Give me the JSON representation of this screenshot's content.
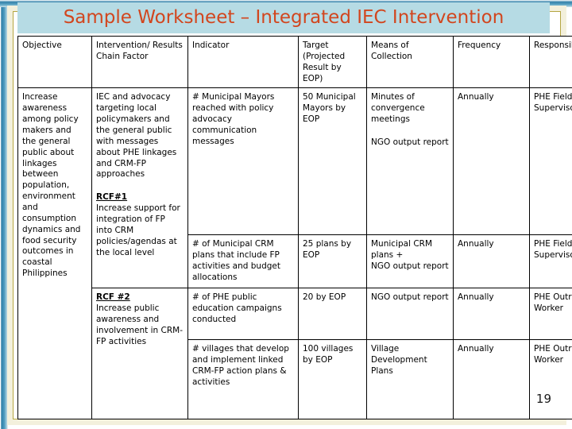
{
  "slide": {
    "title": "Sample Worksheet – Integrated IEC Intervention",
    "page_number": "19",
    "accent_title_color": "#d2461e",
    "title_band_color": "#b6dbe4",
    "frame_color": "#2f7fa8"
  },
  "table": {
    "headers": [
      "Objective",
      "Intervention/ Results Chain Factor",
      "Indicator",
      "Target (Projected Result  by EOP)",
      "Means of Collection",
      "Frequency",
      "Responsible Party"
    ],
    "objective": "Increase awareness among policy makers and the general public about linkages between population, environment and consumption dynamics and food security outcomes in coastal Philippines",
    "intervention_main": "IEC and advocacy targeting local policymakers and the general public with messages about PHE linkages and CRM-FP approaches",
    "rcf1_label": "RCF#1",
    "rcf1_text": "Increase support for integration of FP into CRM policies/agendas at the local level",
    "rcf2_label": "RCF #2",
    "rcf2_text": "Increase public awareness and involvement in CRM-FP activities",
    "rows": [
      {
        "indicator": "# Municipal Mayors reached with policy advocacy communication messages",
        "target": "50 Municipal Mayors by EOP",
        "means_line1": "Minutes of convergence meetings",
        "means_line2": "NGO output report",
        "frequency": "Annually",
        "responsible": "PHE Field Supervisor"
      },
      {
        "indicator": "# of Municipal CRM plans that include FP activities and budget allocations",
        "target": "25 plans by EOP",
        "means_line1": "Municipal CRM plans +",
        "means_line2": "NGO output report",
        "frequency": "Annually",
        "responsible": "PHE Field Supervisor"
      },
      {
        "indicator": "# of PHE public education campaigns conducted",
        "target": "20 by EOP",
        "means_line1": "NGO output report",
        "means_line2": "",
        "frequency": "Annually",
        "responsible": "PHE Outreach Worker"
      },
      {
        "indicator": "# villages that develop and implement linked CRM-FP action plans & activities",
        "target": "100 villages by EOP",
        "means_line1": "Village Development Plans",
        "means_line2": "",
        "frequency": "Annually",
        "responsible": "PHE Outreach Worker"
      }
    ]
  }
}
